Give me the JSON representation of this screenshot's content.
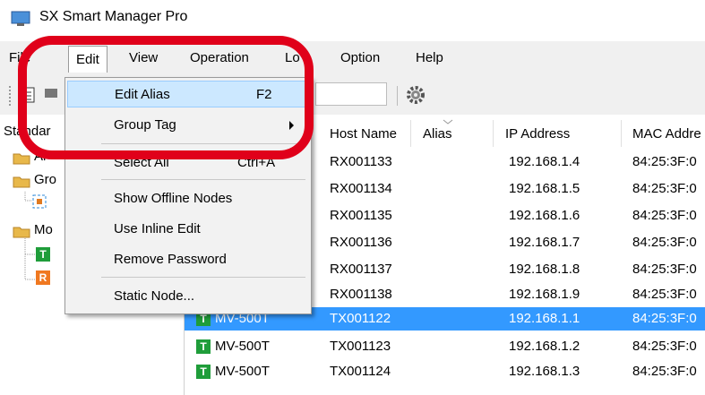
{
  "window": {
    "title": "SX Smart Manager Pro"
  },
  "menubar": {
    "items": [
      {
        "label": "File"
      },
      {
        "label": "Edit"
      },
      {
        "label": "View"
      },
      {
        "label": "Operation"
      },
      {
        "label": "Lo"
      },
      {
        "label": "Option"
      },
      {
        "label": "Help"
      }
    ]
  },
  "edit_menu": {
    "items": [
      {
        "label": "Edit Alias",
        "shortcut": "F2"
      },
      {
        "label": "Group Tag"
      },
      {
        "label": "Select All",
        "shortcut": "Ctrl+A"
      },
      {
        "label": "Show Offline Nodes"
      },
      {
        "label": "Use Inline Edit"
      },
      {
        "label": "Remove Password"
      },
      {
        "label": "Static Node..."
      }
    ]
  },
  "tree": {
    "items": [
      {
        "label": "Standar"
      },
      {
        "label": "Al"
      },
      {
        "label": "Gro"
      },
      {
        "label": "Mo"
      }
    ],
    "badges": [
      "T",
      "R"
    ]
  },
  "table": {
    "columns": [
      "Host Name",
      "Alias",
      "IP Address",
      "MAC Addre"
    ],
    "rows": [
      {
        "model": "",
        "host": "RX001133",
        "ip": "192.168.1.4",
        "mac": "84:25:3F:0"
      },
      {
        "model": "",
        "host": "RX001134",
        "ip": "192.168.1.5",
        "mac": "84:25:3F:0"
      },
      {
        "model": "",
        "host": "RX001135",
        "ip": "192.168.1.6",
        "mac": "84:25:3F:0"
      },
      {
        "model": "",
        "host": "RX001136",
        "ip": "192.168.1.7",
        "mac": "84:25:3F:0"
      },
      {
        "model": "",
        "host": "RX001137",
        "ip": "192.168.1.8",
        "mac": "84:25:3F:0"
      },
      {
        "model": "",
        "host": "RX001138",
        "ip": "192.168.1.9",
        "mac": "84:25:3F:0"
      },
      {
        "model": "MV-500T",
        "host": "TX001122",
        "ip": "192.168.1.1",
        "mac": "84:25:3F:0",
        "selected": true
      },
      {
        "model": "MV-500T",
        "host": "TX001123",
        "ip": "192.168.1.2",
        "mac": "84:25:3F:0"
      },
      {
        "model": "MV-500T",
        "host": "TX001124",
        "ip": "192.168.1.3",
        "mac": "84:25:3F:0"
      }
    ]
  },
  "colors": {
    "selection": "#3399ff",
    "highlight_ring": "#e0001a",
    "tx_badge": "#1f9d3a",
    "rx_badge": "#f07820"
  }
}
